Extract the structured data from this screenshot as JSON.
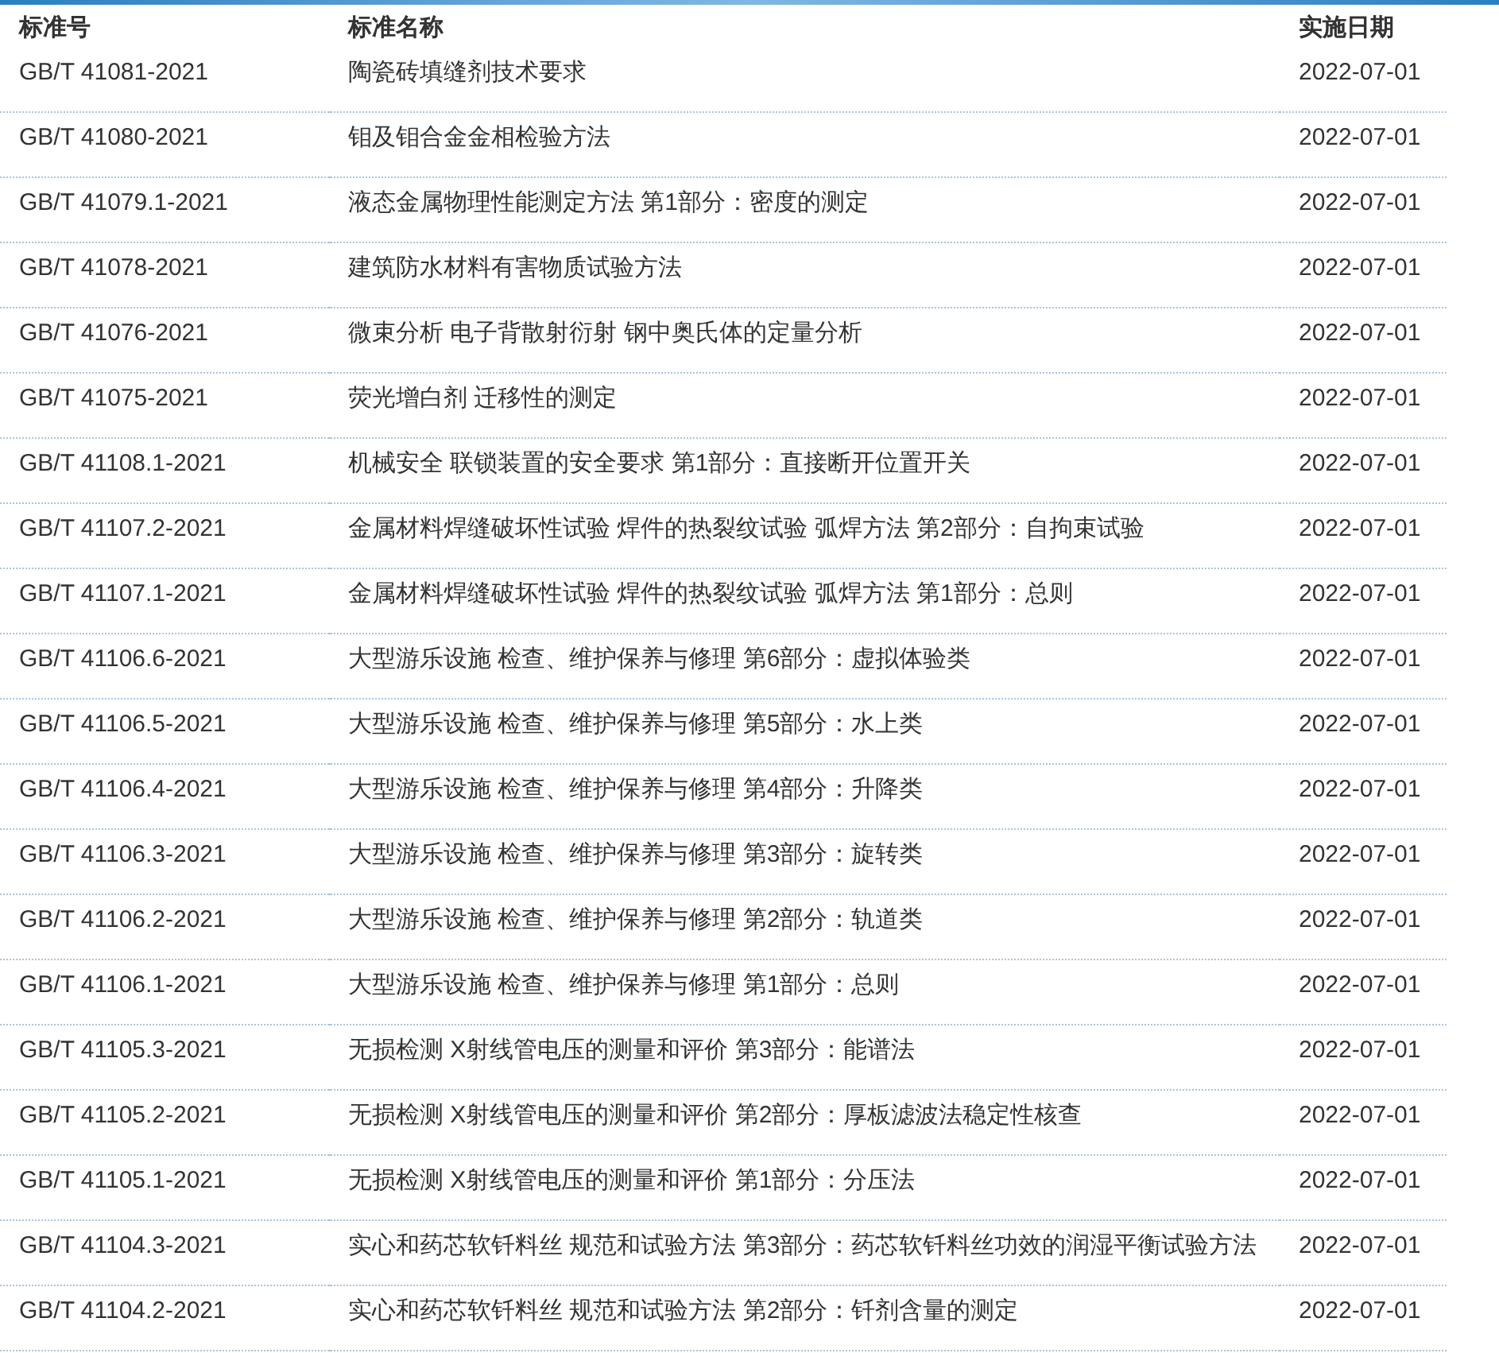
{
  "table": {
    "columns": [
      "标准号",
      "标准名称",
      "实施日期"
    ],
    "rows": [
      [
        "GB/T 41081-2021",
        "陶瓷砖填缝剂技术要求",
        "2022-07-01"
      ],
      [
        "GB/T 41080-2021",
        "钼及钼合金金相检验方法",
        "2022-07-01"
      ],
      [
        "GB/T 41079.1-2021",
        "液态金属物理性能测定方法 第1部分：密度的测定",
        "2022-07-01"
      ],
      [
        "GB/T 41078-2021",
        "建筑防水材料有害物质试验方法",
        "2022-07-01"
      ],
      [
        "GB/T 41076-2021",
        "微束分析 电子背散射衍射 钢中奥氏体的定量分析",
        "2022-07-01"
      ],
      [
        "GB/T 41075-2021",
        "荧光增白剂 迁移性的测定",
        "2022-07-01"
      ],
      [
        "GB/T 41108.1-2021",
        "机械安全 联锁装置的安全要求 第1部分：直接断开位置开关",
        "2022-07-01"
      ],
      [
        "GB/T 41107.2-2021",
        "金属材料焊缝破坏性试验 焊件的热裂纹试验 弧焊方法 第2部分：自拘束试验",
        "2022-07-01"
      ],
      [
        "GB/T 41107.1-2021",
        "金属材料焊缝破坏性试验 焊件的热裂纹试验 弧焊方法 第1部分：总则",
        "2022-07-01"
      ],
      [
        "GB/T 41106.6-2021",
        "大型游乐设施 检查、维护保养与修理 第6部分：虚拟体验类",
        "2022-07-01"
      ],
      [
        "GB/T 41106.5-2021",
        "大型游乐设施 检查、维护保养与修理 第5部分：水上类",
        "2022-07-01"
      ],
      [
        "GB/T 41106.4-2021",
        "大型游乐设施 检查、维护保养与修理 第4部分：升降类",
        "2022-07-01"
      ],
      [
        "GB/T 41106.3-2021",
        "大型游乐设施 检查、维护保养与修理 第3部分：旋转类",
        "2022-07-01"
      ],
      [
        "GB/T 41106.2-2021",
        "大型游乐设施 检查、维护保养与修理 第2部分：轨道类",
        "2022-07-01"
      ],
      [
        "GB/T 41106.1-2021",
        "大型游乐设施 检查、维护保养与修理 第1部分：总则",
        "2022-07-01"
      ],
      [
        "GB/T 41105.3-2021",
        "无损检测 X射线管电压的测量和评价 第3部分：能谱法",
        "2022-07-01"
      ],
      [
        "GB/T 41105.2-2021",
        "无损检测 X射线管电压的测量和评价 第2部分：厚板滤波法稳定性核查",
        "2022-07-01"
      ],
      [
        "GB/T 41105.1-2021",
        "无损检测 X射线管电压的测量和评价 第1部分：分压法",
        "2022-07-01"
      ],
      [
        "GB/T 41104.3-2021",
        "实心和药芯软钎料丝 规范和试验方法 第3部分：药芯软钎料丝功效的润湿平衡试验方法",
        "2022-07-01"
      ],
      [
        "GB/T 41104.2-2021",
        "实心和药芯软钎料丝 规范和试验方法 第2部分：钎剂含量的测定",
        "2022-07-01"
      ]
    ]
  }
}
